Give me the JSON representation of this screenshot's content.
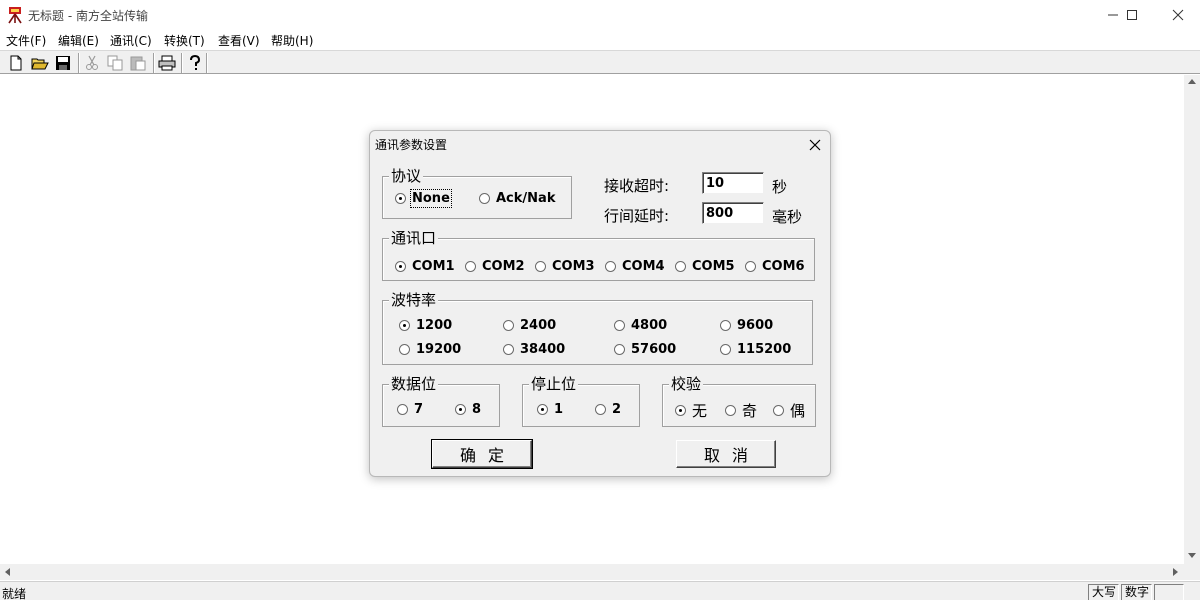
{
  "window": {
    "title": "无标题 - 南方全站传输"
  },
  "menu": [
    {
      "label": "文件(F)"
    },
    {
      "label": "编辑(E)"
    },
    {
      "label": "通讯(C)"
    },
    {
      "label": "转换(T)"
    },
    {
      "label": "查看(V)"
    },
    {
      "label": "帮助(H)"
    }
  ],
  "toolbar": {
    "icons": [
      "new-file-icon",
      "open-folder-icon",
      "save-icon",
      "cut-icon",
      "copy-icon",
      "paste-icon",
      "print-icon",
      "help-icon"
    ]
  },
  "dialog": {
    "title": "通讯参数设置",
    "protocol": {
      "label": "协议",
      "options": [
        "None",
        "Ack/Nak"
      ],
      "selected": "None"
    },
    "receive_timeout": {
      "label": "接收超时:",
      "value": "10",
      "unit": "秒"
    },
    "line_delay": {
      "label": "行间延时:",
      "value": "800",
      "unit": "毫秒"
    },
    "port": {
      "label": "通讯口",
      "options": [
        "COM1",
        "COM2",
        "COM3",
        "COM4",
        "COM5",
        "COM6"
      ],
      "selected": "COM1"
    },
    "baud": {
      "label": "波特率",
      "options": [
        "1200",
        "2400",
        "4800",
        "9600",
        "19200",
        "38400",
        "57600",
        "115200"
      ],
      "selected": "1200"
    },
    "data_bits": {
      "label": "数据位",
      "options": [
        "7",
        "8"
      ],
      "selected": "8"
    },
    "stop_bits": {
      "label": "停止位",
      "options": [
        "1",
        "2"
      ],
      "selected": "1"
    },
    "parity": {
      "label": "校验",
      "options": [
        "无",
        "奇",
        "偶"
      ],
      "selected": "无"
    },
    "ok_label": "确定",
    "cancel_label": "取消"
  },
  "status": {
    "text": "就绪",
    "caps": "大写",
    "num": "数字"
  }
}
